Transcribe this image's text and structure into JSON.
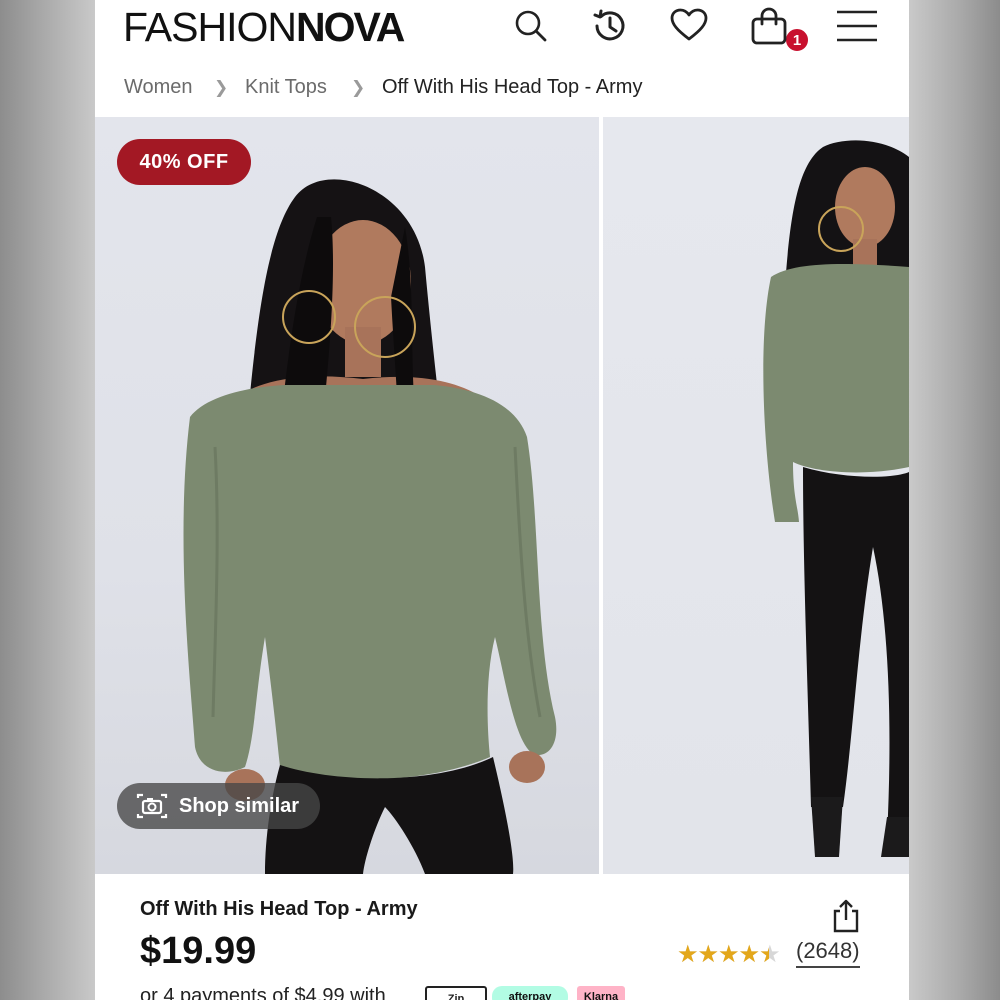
{
  "header": {
    "logo_part1": "FASHION",
    "logo_part2": "NOVA",
    "wishlist_count": "1",
    "icons": [
      "search-icon",
      "history-icon",
      "heart-icon",
      "shopping-bag-icon",
      "menu-icon"
    ]
  },
  "breadcrumb": {
    "items": [
      "Women",
      "Knit Tops",
      "Off With His Head Top - Army"
    ]
  },
  "gallery": {
    "discount_label": "40% OFF",
    "shop_similar_label": "Shop similar"
  },
  "product": {
    "title": "Off With His Head Top - Army",
    "price": "$19.99",
    "rating": 4.5,
    "stars": "★★★★★",
    "review_count": "(2648)",
    "payments_text": "or 4 payments of $4.99 with",
    "payment_providers": [
      "Zip",
      "afterpay",
      "Klarna"
    ]
  },
  "colors": {
    "badge_red": "#a31824",
    "notification_red": "#c8102e",
    "star_gold": "#e3a71b",
    "top_color": "#7c8a70"
  }
}
